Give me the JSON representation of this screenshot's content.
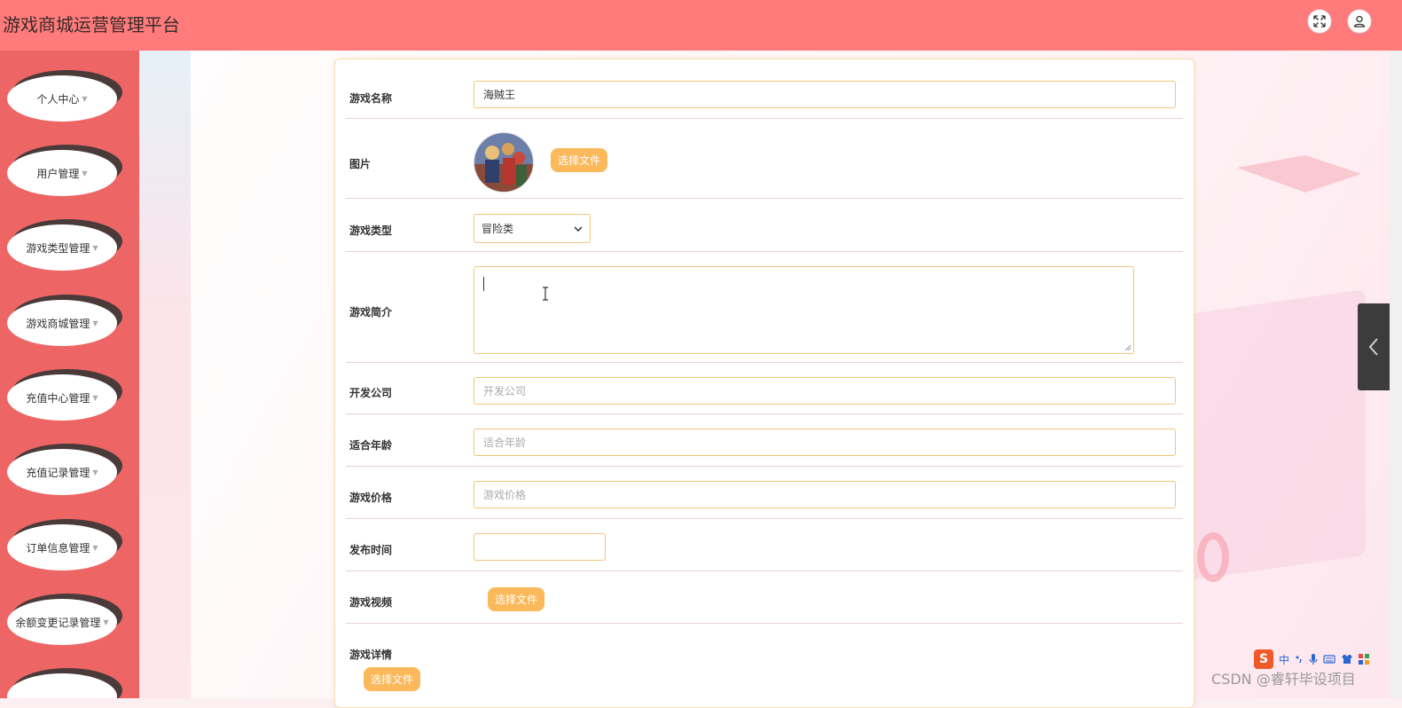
{
  "header": {
    "title": "游戏商城运营管理平台"
  },
  "sidebar": {
    "items": [
      {
        "label": "个人中心"
      },
      {
        "label": "用户管理"
      },
      {
        "label": "游戏类型管理"
      },
      {
        "label": "游戏商城管理"
      },
      {
        "label": "充值中心管理"
      },
      {
        "label": "充值记录管理"
      },
      {
        "label": "订单信息管理"
      },
      {
        "label": "余额变更记录管理"
      },
      {
        "label": ""
      }
    ]
  },
  "form": {
    "name": {
      "label": "游戏名称",
      "value": "海贼王"
    },
    "image": {
      "label": "图片",
      "button": "选择文件"
    },
    "type": {
      "label": "游戏类型",
      "selected": "冒险类"
    },
    "intro": {
      "label": "游戏简介",
      "value": ""
    },
    "developer": {
      "label": "开发公司",
      "placeholder": "开发公司"
    },
    "age": {
      "label": "适合年龄",
      "placeholder": "适合年龄"
    },
    "price": {
      "label": "游戏价格",
      "placeholder": "游戏价格"
    },
    "release": {
      "label": "发布时间",
      "value": ""
    },
    "video": {
      "label": "游戏视频",
      "button": "选择文件"
    },
    "detail": {
      "label": "游戏详情",
      "button": "选择文件"
    }
  },
  "overlay": {
    "watermark": "CSDN @睿轩毕设项目",
    "ime_logo": "S",
    "ime_mode": "中"
  },
  "colors": {
    "topbar": "#ff7b7b",
    "sidebar": "#ee6565",
    "accent_button": "#fbb95c",
    "input_border": "#f2c57a"
  }
}
